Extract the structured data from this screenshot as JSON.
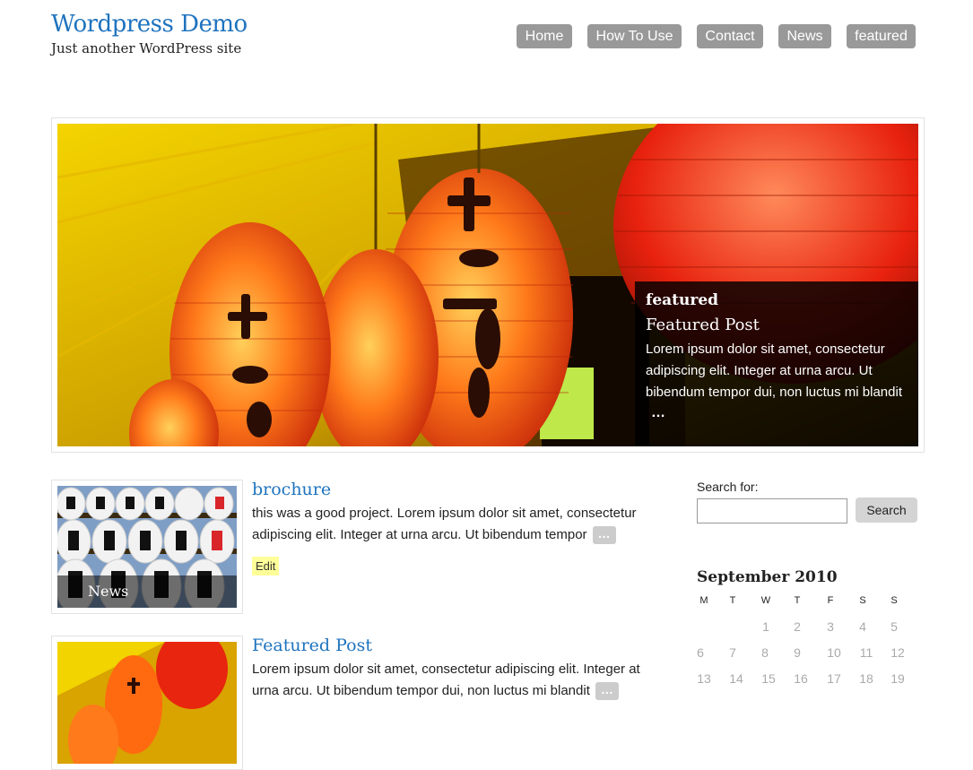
{
  "site": {
    "title": "Wordpress Demo",
    "description": "Just another WordPress site"
  },
  "nav": [
    {
      "label": "Home"
    },
    {
      "label": "How To Use"
    },
    {
      "label": "Contact"
    },
    {
      "label": "News"
    },
    {
      "label": "featured"
    }
  ],
  "slider": {
    "category": "featured",
    "title": "Featured Post",
    "excerpt": "Lorem ipsum dolor sit amet, consectetur adipiscing elit. Integer at urna arcu. Ut bibendum tempor dui, non luctus mi blandit",
    "more": "…"
  },
  "posts": [
    {
      "title": "brochure",
      "excerpt": "this was a good project. Lorem ipsum dolor sit amet, consectetur adipiscing elit. Integer at urna arcu. Ut bibendum tempor",
      "more": "…",
      "category": "News",
      "edit": "Edit"
    },
    {
      "title": "Featured Post",
      "excerpt": "Lorem ipsum dolor sit amet, consectetur adipiscing elit. Integer at urna arcu. Ut bibendum tempor dui, non luctus mi blandit",
      "more": "…"
    }
  ],
  "sidebar": {
    "search_label": "Search for:",
    "search_value": "",
    "search_button": "Search",
    "calendar": {
      "caption": "September 2010",
      "weekdays": [
        "M",
        "T",
        "W",
        "T",
        "F",
        "S",
        "S"
      ],
      "rows": [
        [
          "",
          "",
          "1",
          "2",
          "3",
          "4",
          "5"
        ],
        [
          "6",
          "7",
          "8",
          "9",
          "10",
          "11",
          "12"
        ],
        [
          "13",
          "14",
          "15",
          "16",
          "17",
          "18",
          "19"
        ]
      ]
    }
  },
  "colors": {
    "link": "#1e73be",
    "nav_bg": "#999999",
    "edit_bg": "#ffff99"
  }
}
